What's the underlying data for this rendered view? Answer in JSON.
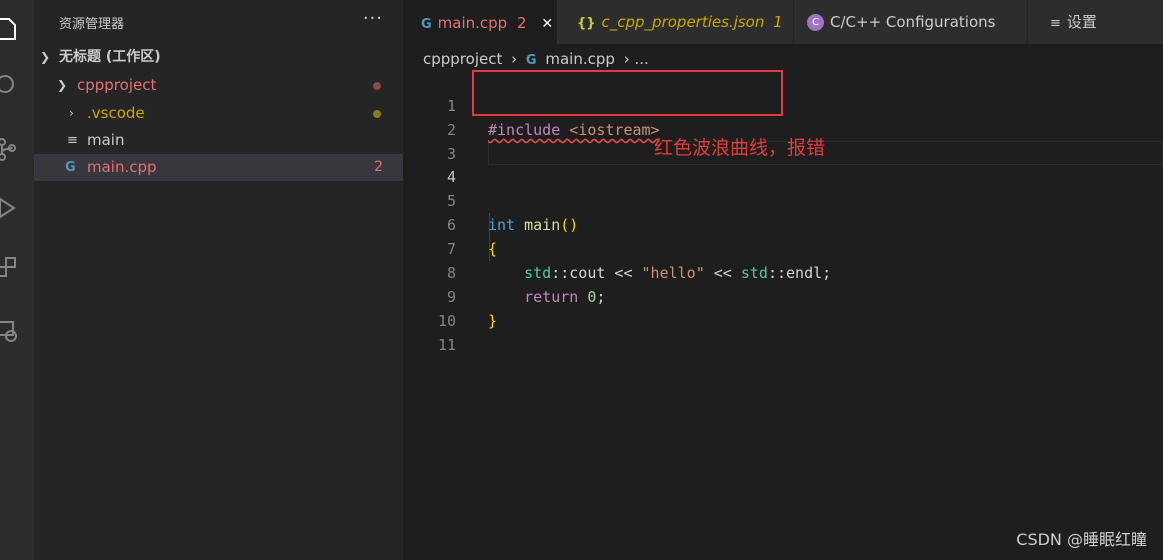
{
  "sidebar": {
    "title": "资源管理器",
    "more": "···",
    "workspace": "无标题 (工作区)",
    "items": [
      {
        "label": "cppproject",
        "color": "#e27272"
      },
      {
        "label": ".vscode",
        "color": "#cca700"
      },
      {
        "label": "main",
        "icon_glyph": "≡"
      },
      {
        "label": "main.cpp",
        "icon_glyph": "G",
        "problems": "2",
        "color": "#e27272"
      }
    ]
  },
  "tabs": [
    {
      "label": "main.cpp",
      "badge": "2",
      "icon_glyph": "G",
      "close": "✕",
      "active": true
    },
    {
      "label": "c_cpp_properties.json",
      "badge": "1",
      "icon_glyph": "{}"
    },
    {
      "label": "C/C++ Configurations",
      "icon_glyph": "C"
    },
    {
      "label": "设置",
      "icon_glyph": "≡"
    }
  ],
  "breadcrumb": {
    "folder": "cppproject",
    "sep": "›",
    "file": "main.cpp",
    "tail": "›  ..."
  },
  "editor": {
    "line_numbers": [
      "1",
      "2",
      "3",
      "4",
      "5",
      "6",
      "7",
      "8",
      "9",
      "10",
      "11"
    ],
    "current_line": "4",
    "lines": {
      "l1_directive": "#include",
      "l1_header": "<iostream>",
      "l5_type": "int",
      "l5_func": "main",
      "l5_parens": "()",
      "l6": "{",
      "l7_indent": "    ",
      "l7_std1": "std",
      "l7_sep1": "::",
      "l7_cout": "cout",
      "l7_op1": " << ",
      "l7_str": "\"hello\"",
      "l7_op2": " << ",
      "l7_std2": "std",
      "l7_sep2": "::",
      "l7_endl": "endl;",
      "l8_indent": "    ",
      "l8_return": "return",
      "l8_num": " 0",
      "l8_semi": ";",
      "l9": "}"
    }
  },
  "annotation": "红色波浪曲线，报错",
  "watermark": "CSDN @睡眠红瞳",
  "colors": {
    "keyword": "#569cd6",
    "preprocessor": "#c586c0",
    "string": "#ce9178",
    "function": "#dcdcaa",
    "namespace": "#4ec9b0",
    "number": "#b5cea8",
    "brace": "#ffd700",
    "error": "#f14c4c",
    "annotation": "#e03c3c"
  }
}
